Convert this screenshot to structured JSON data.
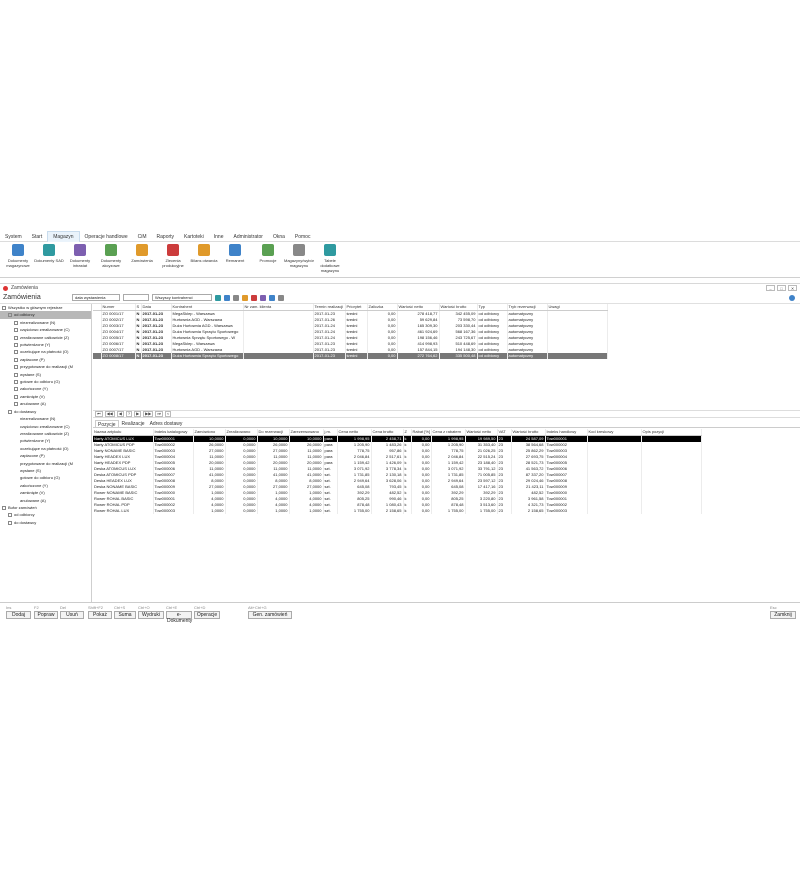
{
  "menu": {
    "items": [
      "System",
      "Start",
      "Magazyn",
      "Operacje handlowe",
      "CiM",
      "Raporty",
      "Kartoteki",
      "Inne",
      "Administrator",
      "Okna",
      "Pomoc"
    ],
    "active_index": 2
  },
  "ribbon": {
    "buttons": [
      {
        "label": "Dokumenty magazynowe",
        "icon": "documents-icon",
        "color": "#3f83c9"
      },
      {
        "label": "Dokumenty SAD",
        "icon": "globe-icon",
        "color": "#2f9aa0"
      },
      {
        "label": "Dokumenty intrastat",
        "icon": "intrastat-icon",
        "color": "#7d5fb0"
      },
      {
        "label": "Dokumenty akcyzowe",
        "icon": "excise-icon",
        "color": "#5aa052"
      },
      {
        "label": "Zamówienia",
        "icon": "bell-icon",
        "color": "#e09a2b"
      },
      {
        "label": "Zlecenia produkcyjne",
        "icon": "production-icon",
        "color": "#cc3c3c"
      },
      {
        "label": "Bilans otwarcia",
        "icon": "balance-icon",
        "color": "#e09a2b"
      },
      {
        "label": "Remanent",
        "icon": "inventory-icon",
        "color": "#3f83c9"
      },
      {
        "label": "Promocje",
        "icon": "tag-icon",
        "color": "#5aa052"
      },
      {
        "label": "Magazyny/wybór magazynu",
        "icon": "warehouse-icon",
        "color": "#888888"
      },
      {
        "label": "Tabele dodatkowe magazynu",
        "icon": "table-plus-icon",
        "color": "#2f9aa0"
      }
    ]
  },
  "window": {
    "title": "Zamówienia",
    "buttons": [
      "–",
      "□",
      "✕"
    ]
  },
  "filter": {
    "title": "Zamówienia",
    "date_mode": "data wystawienia",
    "contractor": "Wszyscy kontrahenci"
  },
  "tree": [
    {
      "label": "Wszystko w głównym rejestrze",
      "lvl": 0
    },
    {
      "label": "od odbiorcy",
      "lvl": 1,
      "sel": true
    },
    {
      "label": "niezrealizowane (N)",
      "lvl": 2
    },
    {
      "label": "częściowo zrealizowane (C)",
      "lvl": 2
    },
    {
      "label": "zrealizowane całkowicie (Z)",
      "lvl": 2
    },
    {
      "label": "potwierdzone (Y)",
      "lvl": 2
    },
    {
      "label": "oczekujące na płatność (O)",
      "lvl": 2
    },
    {
      "label": "zapłacone (P)",
      "lvl": 2
    },
    {
      "label": "przygotowane do realizacji (M",
      "lvl": 2
    },
    {
      "label": "wysłane (S)",
      "lvl": 2
    },
    {
      "label": "gotowe do odbioru (G)",
      "lvl": 2
    },
    {
      "label": "zakończone (Y)",
      "lvl": 2
    },
    {
      "label": "zamknięte (V)",
      "lvl": 2
    },
    {
      "label": "anulowane (A)",
      "lvl": 2
    },
    {
      "label": "do dostawcy",
      "lvl": 1
    },
    {
      "label": "niezrealizowane (N)",
      "lvl": 3
    },
    {
      "label": "częściowo zrealizowane (C)",
      "lvl": 3
    },
    {
      "label": "zrealizowane całkowicie (Z)",
      "lvl": 3
    },
    {
      "label": "potwierdzone (Y)",
      "lvl": 3
    },
    {
      "label": "oczekujące na płatność (O)",
      "lvl": 3
    },
    {
      "label": "zapłacone (P)",
      "lvl": 3
    },
    {
      "label": "przygotowane do realizacji (M",
      "lvl": 3
    },
    {
      "label": "wysłane (S)",
      "lvl": 3
    },
    {
      "label": "gotowe do odbioru (G)",
      "lvl": 3
    },
    {
      "label": "zakończone (Y)",
      "lvl": 3
    },
    {
      "label": "zamknięte (V)",
      "lvl": 3
    },
    {
      "label": "anulowane (A)",
      "lvl": 3
    },
    {
      "label": "Bufor zamówień",
      "lvl": 0
    },
    {
      "label": "od odbiorcy",
      "lvl": 1
    },
    {
      "label": "do dostawcy",
      "lvl": 1
    }
  ],
  "orders": {
    "columns": [
      "",
      "Numer",
      "S",
      "Data",
      "Kontrahent",
      "Nr zam. klienta",
      "Termin realizacji",
      "Priorytet",
      "Zaliczka",
      "Wartość netto",
      "Wartość brutto",
      "Typ",
      "Tryb rezerwacji",
      "Uwagi"
    ],
    "rows": [
      [
        "",
        "ZO 0001/17",
        "N",
        "2017-01-23",
        "MegaSklep - Warszawa",
        "",
        "2017-01-23",
        "średni",
        "0,00",
        "278 418,77",
        "342 455,09",
        "od odbiorcy",
        "automatyczny",
        ""
      ],
      [
        "",
        "ZO 0002/17",
        "N",
        "2017-01-23",
        "Hurtownia AGD - Warszawa",
        "",
        "2017-01-26",
        "średni",
        "0,00",
        "59 629,84",
        "73 598,70",
        "od odbiorcy",
        "automatyczny",
        ""
      ],
      [
        "",
        "ZO 0003/17",
        "N",
        "2017-01-23",
        "Duża Hurtownia AGD - Warszawa",
        "",
        "2017-01-24",
        "średni",
        "0,00",
        "165 309,30",
        "203 330,44",
        "od odbiorcy",
        "automatyczny",
        ""
      ],
      [
        "",
        "ZO 0004/17",
        "N",
        "2017-01-23",
        "Duża Hurtownia Sprzętu Sportowego",
        "",
        "2017-01-24",
        "średni",
        "0,00",
        "461 924,69",
        "568 167,36",
        "od odbiorcy",
        "automatyczny",
        ""
      ],
      [
        "",
        "ZO 0005/17",
        "N",
        "2017-01-23",
        "Hurtownia Sprzętu Sportowego - W",
        "",
        "2017-01-24",
        "średni",
        "0,00",
        "198 156,46",
        "243 725,67",
        "od odbiorcy",
        "automatyczny",
        ""
      ],
      [
        "",
        "ZO 0006/17",
        "N",
        "2017-01-23",
        "MegaSklep - Warszawa",
        "",
        "2017-01-23",
        "średni",
        "0,00",
        "414 998,93",
        "510 448,69",
        "od odbiorcy",
        "automatyczny",
        ""
      ],
      [
        "",
        "ZO 0007/17",
        "N",
        "2017-01-23",
        "Hurtownia AGD - Warszawa",
        "",
        "2017-01-23",
        "średni",
        "0,00",
        "157 844,15",
        "194 148,30",
        "od odbiorcy",
        "automatyczny",
        ""
      ],
      [
        "",
        "ZO 0008/17",
        "N",
        "2017-01-23",
        "Duża Hurtownia Sprzętu Sportowego",
        "",
        "2017-01-23",
        "średni",
        "0,00",
        "272 764,62",
        "335 500,48",
        "od odbiorcy",
        "automatyczny",
        ""
      ]
    ],
    "selected": 7
  },
  "nav": [
    "⏮",
    "◀◀",
    "◀",
    "?",
    "▶",
    "▶▶",
    "⏭",
    "<"
  ],
  "tabs": [
    "Pozycje",
    "Realizacje",
    "Adres dostawy"
  ],
  "positions": {
    "columns": [
      "Nazwa artykułu",
      "Indeks katalogowy",
      "Zamówiono",
      "Zrealizowano",
      "Do rezerwacji",
      "Zarezerwowano",
      "j.m.",
      "Cena netto",
      "Cena brutto",
      "Z",
      "Rabat [%]",
      "Cena z rabatem",
      "Wartość netto",
      "VAT",
      "Wartość brutto",
      "Indeks handlowy",
      "Kod kreskowy",
      "Opis pozycji"
    ],
    "rows": [
      [
        "Narty ATOMICUS LUX",
        "Tow000001",
        "10,0000",
        "0,0000",
        "10,0000",
        "10,0000",
        "para",
        "1 998,95",
        "2 458,71",
        "k",
        "0,00",
        "1 998,95",
        "19 989,50",
        "23",
        "24 587,09",
        "Tow000001",
        "",
        ""
      ],
      [
        "Narty ATOMICUS PDP",
        "Tow000002",
        "26,0000",
        "0,0000",
        "26,0000",
        "26,0000",
        "para",
        "1 205,90",
        "1 483,26",
        "k",
        "0,00",
        "1 205,90",
        "31 353,40",
        "23",
        "38 564,68",
        "Tow000002",
        "",
        ""
      ],
      [
        "Narty NONAME BASIC",
        "Tow000003",
        "27,0000",
        "0,0000",
        "27,0000",
        "11,0000",
        "para",
        "778,75",
        "957,86",
        "k",
        "0,00",
        "778,75",
        "21 026,25",
        "23",
        "25 862,29",
        "Tow000003",
        "",
        ""
      ],
      [
        "Narty HEADEX LUX",
        "Tow000004",
        "11,0000",
        "0,0000",
        "11,0000",
        "11,0000",
        "para",
        "2 046,84",
        "2 517,61",
        "k",
        "0,00",
        "2 046,84",
        "22 515,24",
        "23",
        "27 693,75",
        "Tow000004",
        "",
        ""
      ],
      [
        "Narty HEADEX PDP",
        "Tow000005",
        "20,0000",
        "0,0000",
        "20,0000",
        "20,0000",
        "para",
        "1 159,42",
        "1 426,09",
        "k",
        "0,00",
        "1 159,42",
        "23 188,40",
        "23",
        "28 521,73",
        "Tow000005",
        "",
        ""
      ],
      [
        "Deska ATOMICUS LUX",
        "Tow000006",
        "11,0000",
        "0,0000",
        "11,0000",
        "11,0000",
        "szt.",
        "3 071,92",
        "3 778,34",
        "k",
        "0,00",
        "3 071,92",
        "33 791,12",
        "23",
        "41 563,72",
        "Tow000006",
        "",
        ""
      ],
      [
        "Deska ATOMICUS PDP",
        "Tow000007",
        "41,0000",
        "0,0000",
        "41,0000",
        "41,0000",
        "szt.",
        "1 731,85",
        "2 130,18",
        "k",
        "0,00",
        "1 731,85",
        "71 005,85",
        "23",
        "87 337,20",
        "Tow000007",
        "",
        ""
      ],
      [
        "Deska HEADEX LUX",
        "Tow000008",
        "8,0000",
        "0,0000",
        "8,0000",
        "8,0000",
        "szt.",
        "2 949,64",
        "3 628,06",
        "k",
        "0,00",
        "2 949,64",
        "23 597,12",
        "23",
        "29 024,46",
        "Tow000008",
        "",
        ""
      ],
      [
        "Deska NONAME BASIC",
        "Tow000009",
        "27,0000",
        "0,0000",
        "27,0000",
        "27,0000",
        "szt.",
        "645,08",
        "793,45",
        "k",
        "0,00",
        "645,08",
        "17 417,16",
        "23",
        "21 423,11",
        "Tow000009",
        "",
        ""
      ],
      [
        "Rower NONAME BASIC",
        "Tow000000",
        "1,0000",
        "0,0000",
        "1,0000",
        "1,0000",
        "szt.",
        "392,29",
        "482,52",
        "k",
        "0,00",
        "392,29",
        "392,29",
        "23",
        "482,52",
        "Tow000000",
        "",
        ""
      ],
      [
        "Rower ROHAL BASIC",
        "Tow000001",
        "4,0000",
        "0,0000",
        "4,0000",
        "4,0000",
        "szt.",
        "805,25",
        "990,46",
        "k",
        "0,00",
        "805,25",
        "3 220,80",
        "23",
        "3 961,58",
        "Tow000001",
        "",
        ""
      ],
      [
        "Rower ROHAL PDP",
        "Tow000002",
        "4,0000",
        "0,0000",
        "4,0000",
        "4,0000",
        "szt.",
        "878,48",
        "1 080,43",
        "k",
        "0,00",
        "878,48",
        "3 513,60",
        "23",
        "4 321,73",
        "Tow000002",
        "",
        ""
      ],
      [
        "Rower ROHAL LUX",
        "Tow000003",
        "1,0000",
        "0,0000",
        "1,0000",
        "1,0000",
        "szt.",
        "1 755,00",
        "2 158,65",
        "k",
        "0,00",
        "1 755,00",
        "1 755,00",
        "23",
        "2 158,65",
        "Tow000003",
        "",
        ""
      ]
    ],
    "selected": 0
  },
  "bottom": {
    "keys": [
      [
        "Ins",
        "Dodaj"
      ],
      [
        "F2",
        "Popraw"
      ],
      [
        "Del",
        "Usuń"
      ],
      [
        "Shift+F2",
        "Pokaż"
      ],
      [
        "Ctrl+S",
        "Suma"
      ],
      [
        "Ctrl+O",
        "Wydruki"
      ],
      [
        "Ctrl+E",
        "e-Dokumenty"
      ],
      [
        "Ctrl+D",
        "Operacje"
      ],
      [
        "Alt+Ctrl+G",
        "Gen. zamówień"
      ],
      [
        "Esc",
        "Zamknij"
      ]
    ]
  }
}
